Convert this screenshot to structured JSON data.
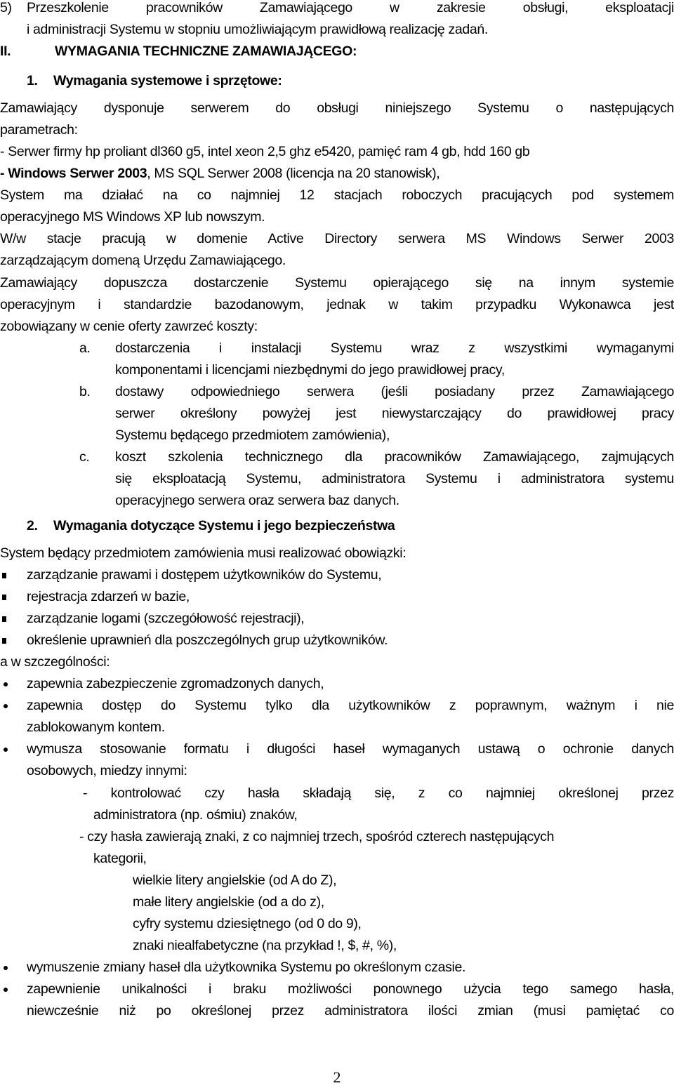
{
  "item5": {
    "marker": "5)",
    "line1": "Przeszkolenie pracowników Zamawiającego w zakresie obsługi, eksploatacji",
    "line2": "i administracji Systemu w stopniu umożliwiającym prawidłową realizację zadań."
  },
  "section2": {
    "numeral": "II.",
    "title": "WYMAGANIA TECHNICZNE ZAMAWIAJĄCEGO:"
  },
  "sub1": {
    "number": "1.",
    "title": "Wymagania systemowe i sprzętowe:"
  },
  "para1": {
    "line1": "Zamawiający dysponuje serwerem do obsługi niniejszego Systemu o następujących",
    "line2": "parametrach:",
    "server_line": "- Serwer firmy hp proliant dl360 g5, intel xeon 2,5 ghz e5420, pamięć ram 4 gb, hdd 160 gb",
    "os_bold": "- Windows Serwer 2003",
    "os_rest": ", MS SQL Serwer 2008 (licencja na 20 stanowisk),",
    "line5": "System ma działać na co najmniej 12 stacjach roboczych pracujących pod systemem",
    "line6": "operacyjnego MS Windows XP lub nowszym.",
    "line7": "W/w stacje pracują w domenie Active Directory serwera MS Windows Serwer 2003",
    "line8": "zarządzającym domeną Urzędu Zamawiającego.",
    "line9": "Zamawiający dopuszcza dostarczenie Systemu opierającego się na innym systemie",
    "line10": "operacyjnym i standardzie bazodanowym, jednak w takim przypadku Wykonawca jest",
    "line11": "zobowiązany w cenie oferty zawrzeć koszty:"
  },
  "cost_items": [
    {
      "marker": "a.",
      "lines": [
        "dostarczenia i instalacji Systemu wraz z wszystkimi wymaganymi",
        "komponentami i licencjami niezbędnymi do jego prawidłowej pracy,"
      ]
    },
    {
      "marker": "b.",
      "lines": [
        "dostawy odpowiedniego serwera (jeśli posiadany przez Zamawiającego",
        "serwer określony powyżej jest niewystarczający do prawidłowej pracy",
        "Systemu będącego przedmiotem zamówienia),"
      ]
    },
    {
      "marker": "c.",
      "lines": [
        "koszt szkolenia technicznego dla pracowników Zamawiającego, zajmujących",
        "się eksploatacją Systemu, administratora Systemu i administratora systemu",
        "operacyjnego serwera oraz serwera baz danych."
      ]
    }
  ],
  "sub2": {
    "number": "2.",
    "title": "Wymagania dotyczące Systemu i jego bezpieczeństwa"
  },
  "duties_intro": "System będący przedmiotem zamówienia musi realizować obowiązki:",
  "duties": [
    "zarządzanie prawami i dostępem użytkowników do Systemu,",
    "rejestracja zdarzeń w bazie,",
    "zarządzanie logami (szczegółowość rejestracji),",
    "określenie uprawnień dla poszczególnych grup użytkowników."
  ],
  "particular_intro": "a w szczególności:",
  "particular": {
    "b1": "zapewnia zabezpieczenie zgromadzonych danych,",
    "b2_l1": "zapewnia dostęp do Systemu tylko dla użytkowników z poprawnym, ważnym i nie",
    "b2_l2": "zablokowanym kontem.",
    "b3_l1": "wymusza stosowanie formatu i długości haseł wymaganych ustawą o ochronie danych",
    "b3_l2": "osobowych, miedzy innymi:",
    "d1_l1": "- kontrolować czy hasła składają się, z co najmniej określonej przez",
    "d1_l2": "administratora (np. ośmiu) znaków,",
    "d2_l1": "- czy hasła zawierają znaki, z co najmniej trzech, spośród czterech następujących",
    "d2_l2": "kategorii,",
    "categories": [
      "wielkie litery angielskie (od A do Z),",
      "małe litery angielskie (od a do z),",
      "cyfry systemu dziesiętnego (od 0 do 9),",
      "znaki niealfabetyczne (na przykład !, $, #, %),"
    ],
    "b4": "wymuszenie zmiany haseł dla użytkownika Systemu po określonym czasie.",
    "b5_l1": "zapewnienie unikalności i braku możliwości ponownego użycia tego samego hasła,",
    "b5_l2": "niewcześnie niż po określonej przez administratora ilości zmian (musi pamiętać co"
  },
  "page_number": "2"
}
